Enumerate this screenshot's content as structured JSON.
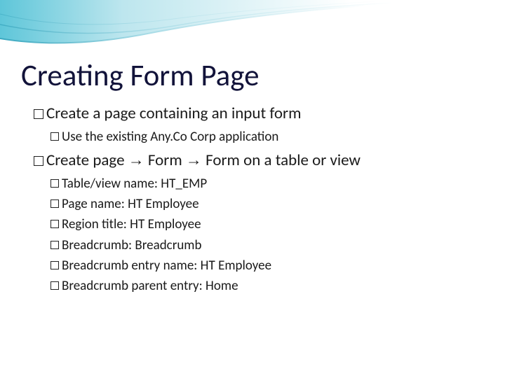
{
  "title": "Creating Form Page",
  "bullets": {
    "b1": "Create a page containing an input form",
    "b1a": "Use the existing Any.Co Corp application",
    "b2_pre": "Create page ",
    "b2_mid": " Form ",
    "b2_post": " Form on a table or view",
    "arrow": "→",
    "c1": "Table/view name: HT_EMP",
    "c2": "Page name: HT Employee",
    "c3": "Region title: HT Employee",
    "c4": "Breadcrumb: Breadcrumb",
    "c5": "Breadcrumb entry name: HT Employee",
    "c6": "Breadcrumb parent entry: Home"
  }
}
